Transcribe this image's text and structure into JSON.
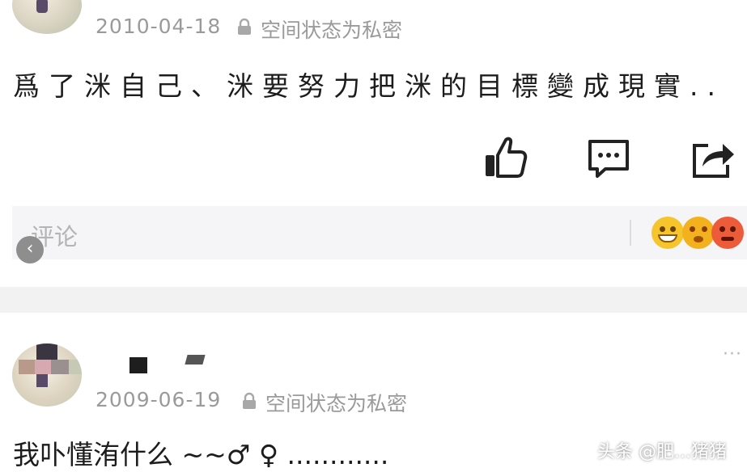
{
  "post1": {
    "date": "2010-04-18",
    "privacy": "空间状态为私密",
    "text": "爲了洣自己、洣要努力把洣的目標變成現實.."
  },
  "actions": {
    "like_icon": "thumbs-up-icon",
    "comment_icon": "comment-bubble-icon",
    "share_icon": "share-arrow-icon"
  },
  "comment_bar": {
    "placeholder": "评论",
    "emojis": [
      "grinning-emoji",
      "dizzy-emoji",
      "angry-emoji"
    ]
  },
  "post2": {
    "date": "2009-06-19",
    "privacy": "空间状态为私密",
    "text": "我卟懂洧什么 ~~♂ ♀ ............",
    "more": "···"
  },
  "watermark": "头条 @肥...猪猪",
  "colors": {
    "muted": "#9a9a9a",
    "bar_bg": "#f5f5f7",
    "separator": "#f2f2f2"
  }
}
